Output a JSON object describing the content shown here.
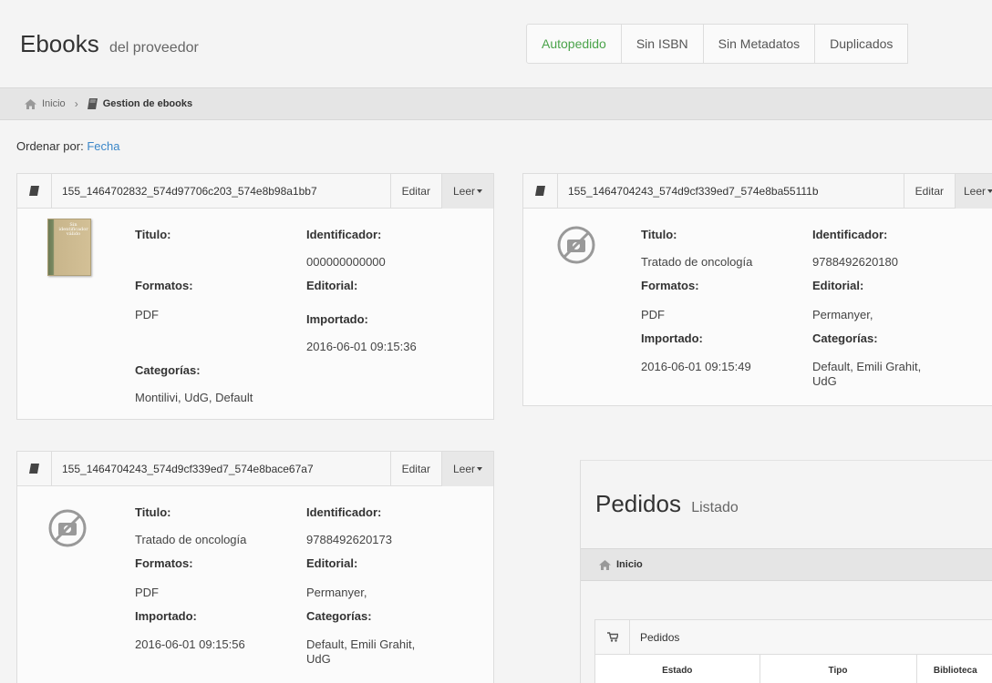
{
  "header": {
    "title": "Ebooks",
    "subtitle": "del proveedor",
    "tabs": [
      {
        "label": "Autopedido",
        "active": true
      },
      {
        "label": "Sin ISBN"
      },
      {
        "label": "Sin Metadatos"
      },
      {
        "label": "Duplicados"
      }
    ]
  },
  "breadcrumb": {
    "home": "Inicio",
    "current": "Gestion de ebooks"
  },
  "order": {
    "label": "Ordenar por:",
    "value": "Fecha"
  },
  "labels": {
    "titulo": "Titulo:",
    "identificador": "Identificador:",
    "formatos": "Formatos:",
    "editorial": "Editorial:",
    "importado": "Importado:",
    "categorias": "Categorías:",
    "editar": "Editar",
    "leer": "Leer"
  },
  "ebooks": [
    {
      "id": "155_1464702832_574d97706c203_574e8b98a1bb7",
      "titulo": "",
      "identificador": "000000000000",
      "formatos": "PDF",
      "editorial": "",
      "importado": "2016-06-01 09:15:36",
      "categorias": "Montilivi, UdG, Default",
      "cover_text": "Sin identificador válido"
    },
    {
      "id": "155_1464704243_574d9cf339ed7_574e8ba55111b",
      "titulo": "Tratado de oncología",
      "identificador": "9788492620180",
      "formatos": "PDF",
      "editorial": "Permanyer,",
      "importado": "2016-06-01 09:15:49",
      "categorias_line1": "Default, Emili Grahit,",
      "categorias_line2": "UdG"
    },
    {
      "id": "155_1464704243_574d9cf339ed7_574e8bace67a7",
      "titulo": "Tratado de oncología",
      "identificador": "9788492620173",
      "formatos": "PDF",
      "editorial": "Permanyer,",
      "importado": "2016-06-01 09:15:56",
      "categorias_line1": "Default, Emili Grahit,",
      "categorias_line2": "UdG"
    }
  ],
  "pedidos": {
    "title": "Pedidos",
    "subtitle": "Listado",
    "breadcrumb_home": "Inicio",
    "panel_title": "Pedidos",
    "columns": [
      "Estado",
      "Tipo",
      "Biblioteca"
    ]
  },
  "colors": {
    "active_tab": "#4aa34a",
    "link": "#3a86c8"
  }
}
